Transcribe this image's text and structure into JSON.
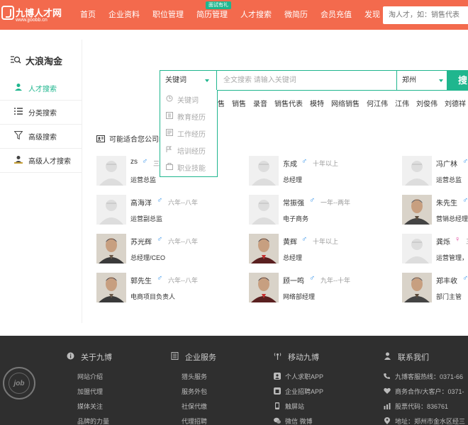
{
  "header": {
    "logo_name": "九博人才网",
    "logo_url": "www.jjoobb.cn",
    "nav": [
      {
        "label": "首页"
      },
      {
        "label": "企业资料"
      },
      {
        "label": "职位管理"
      },
      {
        "label": "简历管理",
        "tag": "面试有礼"
      },
      {
        "label": "人才搜索"
      },
      {
        "label": "微简历"
      },
      {
        "label": "会员充值"
      },
      {
        "label": "发现"
      }
    ],
    "search_placeholder": "淘人才，如：销售代表"
  },
  "sidebar": {
    "title": "大浪淘金",
    "items": [
      {
        "label": "人才搜索",
        "icon": "person-icon",
        "active": true
      },
      {
        "label": "分类搜索",
        "icon": "list-icon"
      },
      {
        "label": "高级搜索",
        "icon": "filter-icon"
      },
      {
        "label": "高级人才搜索",
        "icon": "advanced-person-icon"
      }
    ]
  },
  "search": {
    "select_value": "关键词",
    "keyword_placeholder": "全文搜索 请输入关键词",
    "city": "郑州",
    "button_label": "搜",
    "dropdown": [
      {
        "label": "关键词",
        "icon": "keyword-icon"
      },
      {
        "label": "教育经历",
        "icon": "education-icon"
      },
      {
        "label": "工作经历",
        "icon": "work-icon"
      },
      {
        "label": "培训经历",
        "icon": "training-icon"
      },
      {
        "label": "职业技能",
        "icon": "skill-icon"
      }
    ],
    "hot_keywords": [
      "售",
      "销售",
      "录音",
      "销售代表",
      "模特",
      "网络销售",
      "何江伟",
      "江伟",
      "刘俊伟",
      "刘德祥"
    ]
  },
  "results": {
    "title": "可能适合您公司的",
    "candidates": [
      {
        "name": "zs",
        "gender": "male",
        "experience": "三",
        "job": "运营总监",
        "photo": false
      },
      {
        "name": "东成",
        "gender": "male",
        "experience": "十年以上",
        "job": "总经理",
        "photo": false
      },
      {
        "name": "冯广林",
        "gender": "male",
        "experience": "",
        "job": "运营总监",
        "photo": false
      },
      {
        "name": "高海洋",
        "gender": "male",
        "experience": "六年--八年",
        "job": "运营副总监",
        "photo": false
      },
      {
        "name": "常振强",
        "gender": "male",
        "experience": "一年--两年",
        "job": "电子商务",
        "photo": false
      },
      {
        "name": "朱先生",
        "gender": "male",
        "experience": "",
        "job": "营销总经理",
        "photo": true
      },
      {
        "name": "苏光辉",
        "gender": "male",
        "experience": "六年--八年",
        "job": "总经理/CEO",
        "photo": true
      },
      {
        "name": "黄辉",
        "gender": "male",
        "experience": "十年以上",
        "job": "总经理",
        "photo": true
      },
      {
        "name": "龚烁",
        "gender": "female",
        "experience": "三",
        "job": "运营管理，",
        "photo": false
      },
      {
        "name": "郭先生",
        "gender": "male",
        "experience": "六年--八年",
        "job": "电商项目负责人",
        "photo": true
      },
      {
        "name": "顾一鸣",
        "gender": "male",
        "experience": "九年--十年",
        "job": "网络部经理",
        "photo": true
      },
      {
        "name": "郑丰收",
        "gender": "male",
        "experience": "",
        "job": "部门主管",
        "photo": true
      }
    ]
  },
  "footer": {
    "seal_text": "job",
    "columns": [
      {
        "title": "关于九博",
        "icon": "info-icon",
        "links": [
          {
            "label": "网站介绍"
          },
          {
            "label": "加盟代理"
          },
          {
            "label": "媒体关注"
          },
          {
            "label": "品牌的力量"
          }
        ]
      },
      {
        "title": "企业服务",
        "icon": "document-icon",
        "links": [
          {
            "label": "猎头服务"
          },
          {
            "label": "服务外包"
          },
          {
            "label": "社保代缴"
          },
          {
            "label": "代理招聘"
          }
        ]
      },
      {
        "title": "移动九博",
        "icon": "signal-icon",
        "links": [
          {
            "label": "个人求职APP",
            "icon": "person-app-icon"
          },
          {
            "label": "企业招聘APP",
            "icon": "company-app-icon"
          },
          {
            "label": "触屏站",
            "icon": "phone-icon"
          },
          {
            "label": "微信 微博",
            "icon": "wechat-icon"
          }
        ]
      },
      {
        "title": "联系我们",
        "icon": "user-icon",
        "links": [
          {
            "label": "九博客服热线：0371-66",
            "icon": "phone-call-icon"
          },
          {
            "label": "商务合作/大客户：0371-",
            "icon": "heart-icon"
          },
          {
            "label": "股票代码：836761",
            "icon": "stock-icon"
          },
          {
            "label": "地址：郑州市金水区经三",
            "icon": "location-icon"
          }
        ]
      }
    ]
  },
  "colors": {
    "brand": "#f36a4d",
    "accent": "#1fb68e",
    "male": "#2e8fe8",
    "female": "#e0409a",
    "footer": "#2f2f2f"
  }
}
